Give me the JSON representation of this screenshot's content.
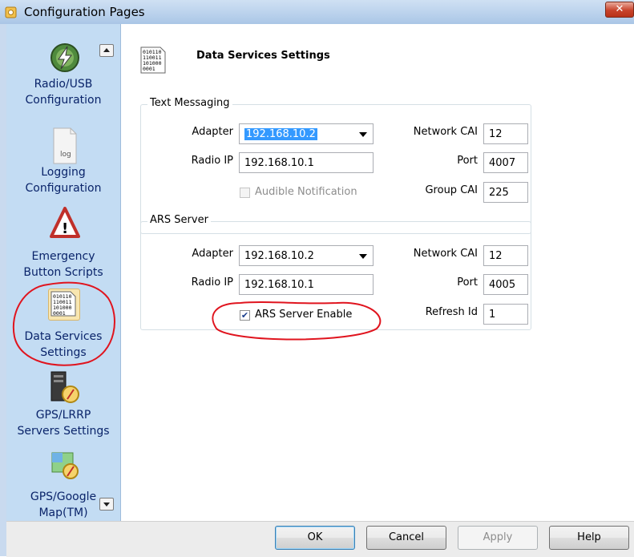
{
  "window": {
    "title": "Configuration Pages",
    "close_symbol": "✕"
  },
  "sidebar": {
    "items": [
      {
        "line1": "Radio/USB",
        "line2": "Configuration",
        "icon": "radio-lightning-icon"
      },
      {
        "line1": "Logging",
        "line2": "Configuration",
        "icon": "log-file-icon",
        "icon_text": "log"
      },
      {
        "line1": "Emergency",
        "line2": "Button Scripts",
        "icon": "warning-triangle-icon",
        "icon_text": "!"
      },
      {
        "line1": "Data Services",
        "line2": "Settings",
        "icon": "binary-data-icon",
        "selected": true
      },
      {
        "line1": "GPS/LRRP",
        "line2": "Servers Settings",
        "icon": "gps-server-icon"
      },
      {
        "line1": "GPS/Google",
        "line2": "Map(TM)",
        "icon": "gps-map-icon"
      }
    ],
    "binary_icon_lines": [
      "010110",
      "110011",
      "101000",
      "0001"
    ]
  },
  "page": {
    "title": "Data Services Settings",
    "text_messaging": {
      "group_label": "Text Messaging",
      "adapter_label": "Adapter",
      "adapter_value": "192.168.10.2",
      "radio_ip_label": "Radio IP",
      "radio_ip_value": "192.168.10.1",
      "audible_label": "Audible Notification",
      "audible_checked": false,
      "network_cai_label": "Network CAI",
      "network_cai_value": "12",
      "port_label": "Port",
      "port_value": "4007",
      "group_cai_label": "Group CAI",
      "group_cai_value": "225"
    },
    "ars_server": {
      "group_label": "ARS Server",
      "adapter_label": "Adapter",
      "adapter_value": "192.168.10.2",
      "radio_ip_label": "Radio IP",
      "radio_ip_value": "192.168.10.1",
      "enable_label": "ARS Server Enable",
      "enable_checked": true,
      "check_mark": "✔",
      "network_cai_label": "Network CAI",
      "network_cai_value": "12",
      "port_label": "Port",
      "port_value": "4005",
      "refresh_id_label": "Refresh Id",
      "refresh_id_value": "1"
    }
  },
  "buttons": {
    "ok": "OK",
    "cancel": "Cancel",
    "apply": "Apply",
    "help": "Help"
  },
  "annotation_color": "#e0141e"
}
